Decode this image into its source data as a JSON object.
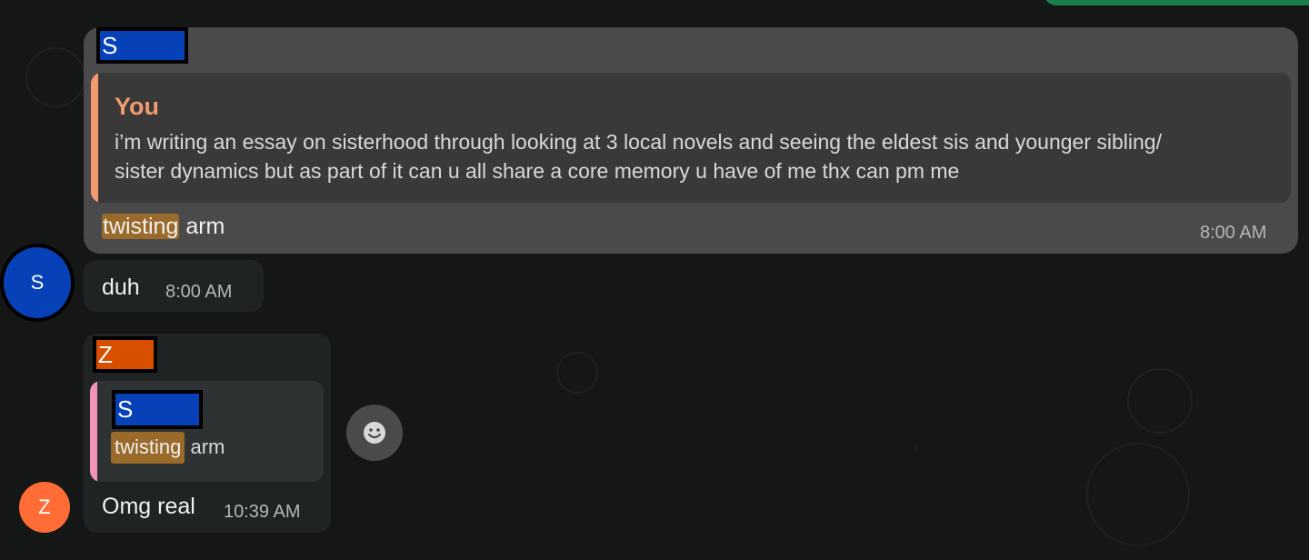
{
  "messages": [
    {
      "sender_label": "S",
      "quote_author": "You",
      "quote_text_line1": "i’m writing an essay on sisterhood through looking at 3 local novels and seeing the eldest sis and younger sibling/",
      "quote_text_line2": "sister dynamics but as part of it can u all share a core memory u have of me thx can pm me",
      "text_highlight": "twisting",
      "text_rest": " arm",
      "time": "8:00 AM"
    },
    {
      "avatar_initial": "S",
      "text": "duh",
      "time": "8:00 AM"
    },
    {
      "sender_label": "Z",
      "quote_sender_label": "S",
      "quote_text_highlight": "twisting",
      "quote_text_rest": " arm",
      "text": "Omg real",
      "time": "10:39 AM",
      "avatar_initial": "Z"
    }
  ],
  "icons": {
    "emoji": "smile-face-icon"
  },
  "colors": {
    "blue_tag": "#0741b8",
    "orange_tag": "#d84f00",
    "quote_author": "#f39a71",
    "highlight": "#9a6a2a",
    "avatar_blue": "#0741b8",
    "avatar_orange": "#ff6c35"
  }
}
